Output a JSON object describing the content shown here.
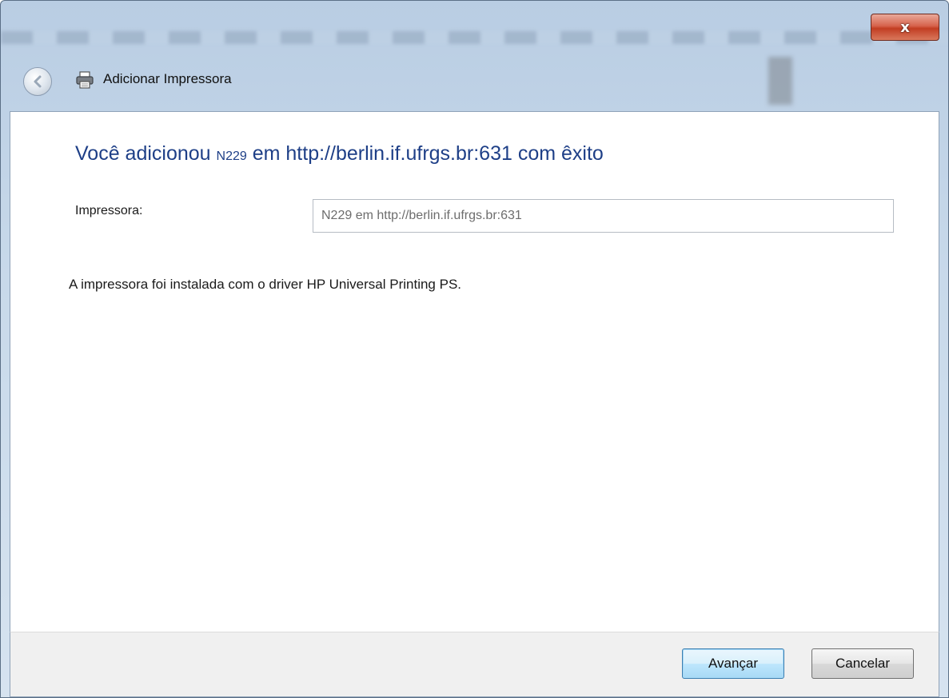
{
  "window": {
    "title": "Adicionar Impressora",
    "close_label": "x"
  },
  "content": {
    "heading_prefix": "Você adicionou ",
    "heading_printer": "N229",
    "heading_suffix": " em http://berlin.if.ufrgs.br:631 com êxito",
    "printer_label": "Impressora:",
    "printer_value": "N229 em http://berlin.if.ufrgs.br:631",
    "info": "A impressora foi instalada com o driver HP Universal Printing PS."
  },
  "footer": {
    "next_label": "Avançar",
    "cancel_label": "Cancelar"
  },
  "icons": {
    "back": "back-arrow-icon",
    "printer": "printer-icon",
    "close": "close-icon"
  },
  "colors": {
    "heading": "#1e3f87",
    "close_button": "#c23d22",
    "default_button_border": "#3c7fb1"
  }
}
